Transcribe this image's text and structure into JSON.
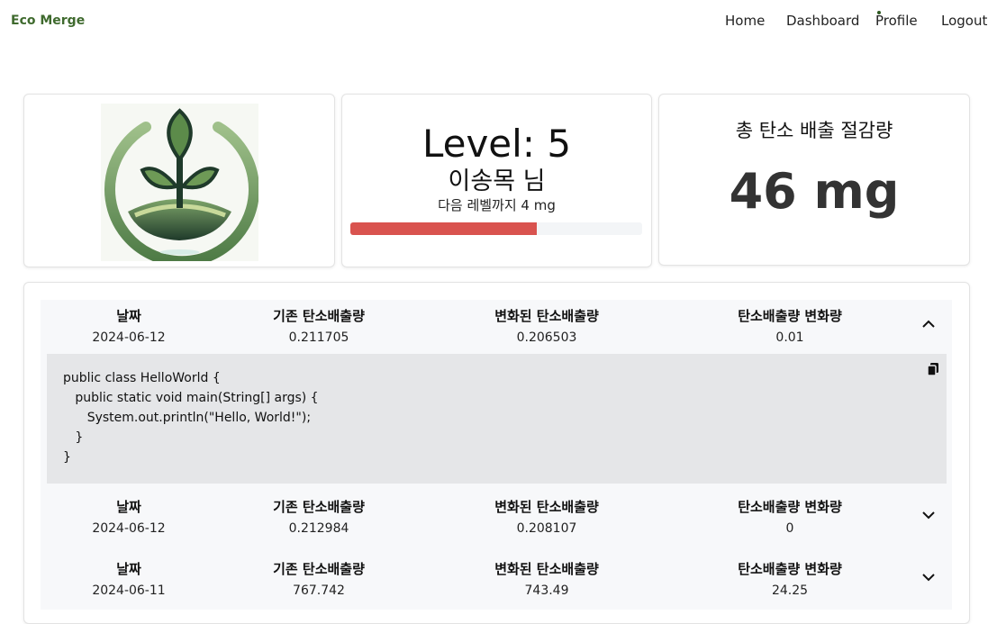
{
  "nav": {
    "brand": "Eco Merge",
    "links": [
      "Home",
      "Dashboard",
      "Profile",
      "Logout"
    ]
  },
  "level_card": {
    "level": "Level: 5",
    "name": "이송목 님",
    "next": "다음 레벨까지 4 mg",
    "progress_fraction": 0.64,
    "progress_color": "#d9534f"
  },
  "total_card": {
    "label": "총 탄소 배출 절감량",
    "value": "46 mg"
  },
  "history": {
    "headers": [
      "날짜",
      "기존 탄소배출량",
      "변화된 탄소배출량",
      "탄소배출량 변화량"
    ],
    "rows": [
      {
        "date": "2024-06-12",
        "before": "0.211705",
        "after": "0.206503",
        "change": "0.01",
        "expanded": true
      },
      {
        "date": "2024-06-12",
        "before": "0.212984",
        "after": "0.208107",
        "change": "0",
        "expanded": false
      },
      {
        "date": "2024-06-11",
        "before": "767.742",
        "after": "743.49",
        "change": "24.25",
        "expanded": false
      }
    ],
    "code": "public class HelloWorld {\n   public static void main(String[] args) {\n      System.out.println(\"Hello, World!\");\n   }\n}"
  },
  "icons": [
    "logo-sprout-icon",
    "chevron-up-icon",
    "chevron-down-icon",
    "copy-icon"
  ],
  "colors": {
    "brand": "#3f6a2e",
    "progress": "#d9534f"
  }
}
